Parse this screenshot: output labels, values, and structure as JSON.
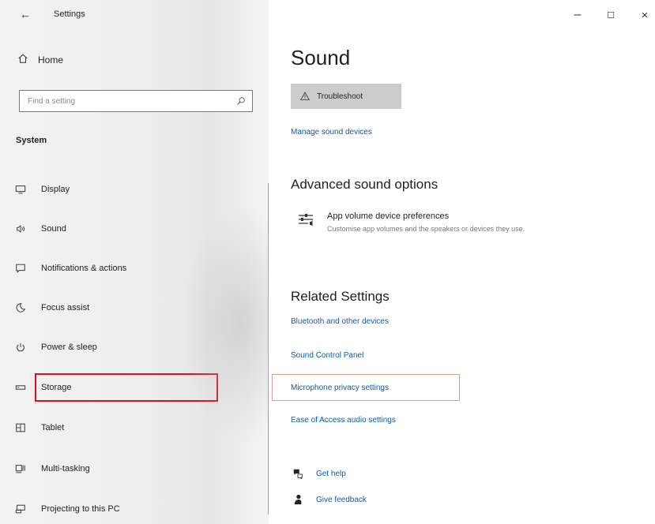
{
  "window": {
    "app_title": "Settings",
    "back_glyph": "←",
    "minimize_glyph": "–",
    "maximize_glyph": "☐",
    "close_glyph": "✕"
  },
  "sidebar": {
    "home_label": "Home",
    "search_placeholder": "Find a setting",
    "section_label": "System",
    "items": [
      {
        "label": "Display",
        "icon": "display-icon"
      },
      {
        "label": "Sound",
        "icon": "sound-icon"
      },
      {
        "label": "Notifications & actions",
        "icon": "notifications-icon"
      },
      {
        "label": "Focus assist",
        "icon": "focus-assist-icon"
      },
      {
        "label": "Power & sleep",
        "icon": "power-icon"
      },
      {
        "label": "Storage",
        "icon": "storage-icon",
        "highlighted": true
      },
      {
        "label": "Tablet",
        "icon": "tablet-icon"
      },
      {
        "label": "Multi-tasking",
        "icon": "multitasking-icon"
      },
      {
        "label": "Projecting to this PC",
        "icon": "projecting-icon"
      }
    ]
  },
  "main": {
    "title": "Sound",
    "troubleshoot_label": "Troubleshoot",
    "manage_link": "Manage sound devices",
    "advanced_heading": "Advanced sound options",
    "advanced_item_title": "App volume  device preferences",
    "advanced_item_desc": "Customise app volumes and the speakers or devices they use.",
    "related_heading": "Related Settings",
    "related_links": [
      "Bluetooth and other devices",
      "Sound Control Panel",
      "Microphone privacy settings",
      "Ease of Access audio settings"
    ],
    "help_label": "Get help",
    "feedback_label": "Give feedback"
  },
  "colors": {
    "link": "#0b5cad",
    "highlight_border": "#d9111d",
    "button_bg": "#cccccc"
  }
}
